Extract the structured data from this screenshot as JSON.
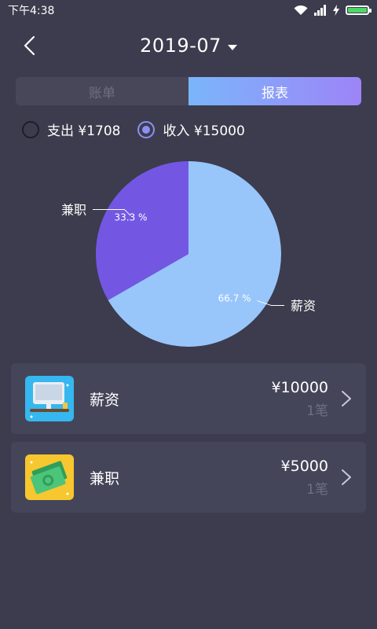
{
  "status_bar": {
    "time": "下午4:38",
    "battery_level": 1.0,
    "battery_color": "#4cd964"
  },
  "header": {
    "title": "2019-07"
  },
  "tabs": [
    {
      "label": "账单",
      "active": false
    },
    {
      "label": "报表",
      "active": true
    }
  ],
  "filter": {
    "expense_label": "支出 ¥1708",
    "income_label": "收入 ¥15000",
    "selected": "income"
  },
  "chart_data": {
    "type": "pie",
    "slices": [
      {
        "name": "薪资",
        "value": 66.7,
        "label": "66.7 %",
        "color": "#98c6fb"
      },
      {
        "name": "兼职",
        "value": 33.3,
        "label": "33.3 %",
        "color": "#7357e3"
      }
    ]
  },
  "items": [
    {
      "name": "薪资",
      "amount": "¥10000",
      "count": "1笔",
      "icon": "desk-computer-icon"
    },
    {
      "name": "兼职",
      "amount": "¥5000",
      "count": "1笔",
      "icon": "cash-bills-icon"
    }
  ],
  "colors": {
    "background": "#3c3c4e",
    "card": "#45455a",
    "accent": "#8e8ff3"
  }
}
